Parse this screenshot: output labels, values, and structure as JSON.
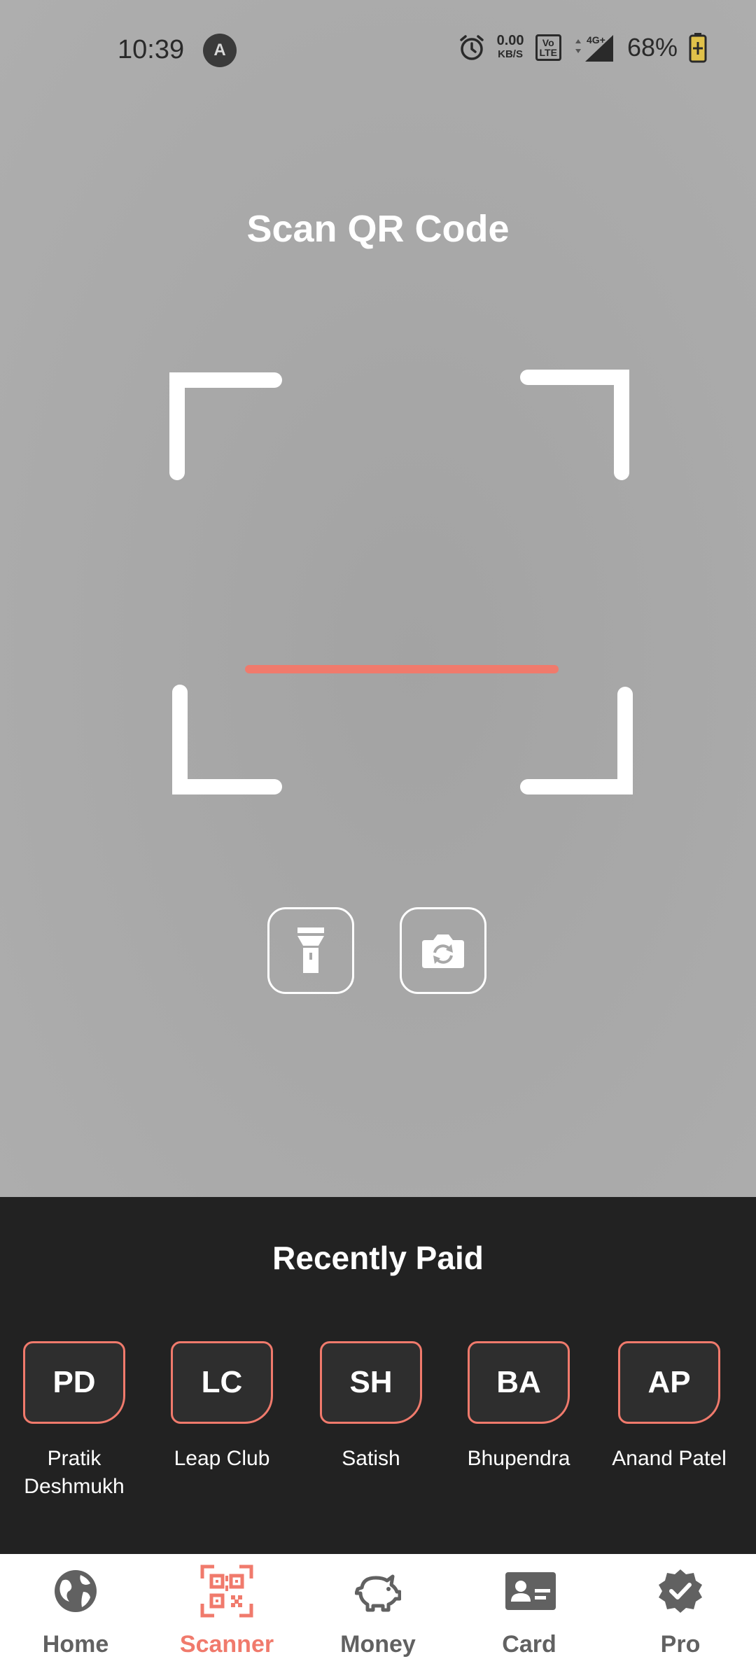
{
  "status_bar": {
    "time": "10:39",
    "app_icon": "A",
    "net_speed_value": "0.00",
    "net_speed_unit": "KB/S",
    "volte_top": "Vo",
    "volte_bottom": "LTE",
    "network_label": "4G+",
    "battery_percent": "68%"
  },
  "scanner": {
    "title": "Scan QR Code",
    "accent_color": "#f07a6c",
    "icons": {
      "flashlight": "flashlight-icon",
      "flip_camera": "flip-camera-icon"
    }
  },
  "recently_paid": {
    "title": "Recently Paid",
    "contacts": [
      {
        "initials": "PD",
        "name_line1": "Pratik",
        "name_line2": "Deshmukh"
      },
      {
        "initials": "LC",
        "name_line1": "Leap Club",
        "name_line2": ""
      },
      {
        "initials": "SH",
        "name_line1": "Satish",
        "name_line2": ""
      },
      {
        "initials": "BA",
        "name_line1": "Bhupendra",
        "name_line2": ""
      },
      {
        "initials": "AP",
        "name_line1": "Anand Patel",
        "name_line2": ""
      }
    ]
  },
  "nav": {
    "active": "Scanner",
    "items": [
      {
        "label": "Home",
        "icon": "globe-icon"
      },
      {
        "label": "Scanner",
        "icon": "qr-scanner-icon"
      },
      {
        "label": "Money",
        "icon": "piggy-bank-icon"
      },
      {
        "label": "Card",
        "icon": "id-card-icon"
      },
      {
        "label": "Pro",
        "icon": "verified-badge-icon"
      }
    ]
  }
}
